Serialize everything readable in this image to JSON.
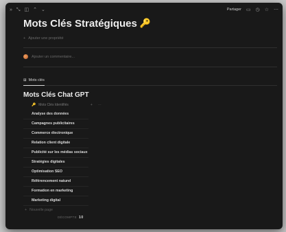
{
  "topbar": {
    "nav_icons": [
      "double-chevron-icon",
      "expand-icon",
      "sidebar-icon",
      "chevron-up-icon",
      "chevron-down-icon"
    ],
    "share_label": "Partager",
    "right_icons": [
      "comment-icon",
      "clock-icon",
      "star-icon",
      "more-icon"
    ]
  },
  "page": {
    "title": "Mots Clés Stratégiques",
    "title_icon": "key-icon",
    "add_property": "Ajouter une propriété",
    "add_comment": "Ajouter un commentaire..."
  },
  "database": {
    "tab_label": "Mots clés",
    "title": "Mots Clés Chat GPT",
    "column_header": "Mots Clés Identifiés",
    "rows": [
      "Analyse des données",
      "Campagnes publicitaires",
      "Commerce électronique",
      "Relation client digitale",
      "Publicité sur les médias sociaux",
      "Stratégies digitales",
      "Optimisation SEO",
      "Référencement naturel",
      "Formation en marketing",
      "Marketing digital"
    ],
    "new_page": "Nouvelle page",
    "count_label": "DÉCOMPTE",
    "count_value": "10"
  },
  "colors": {
    "background": "#191919",
    "text": "#e6e6e6",
    "muted": "#6a6a6a",
    "key_accent": "#e8b923"
  }
}
